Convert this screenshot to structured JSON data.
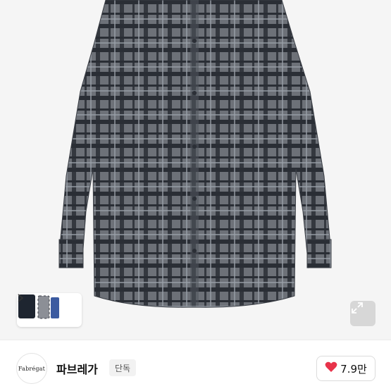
{
  "hero": {
    "image": "plaid-shirt-product-photo",
    "expand_icon": "expand-icon",
    "thumbnails_icon": "chevron-right-icon"
  },
  "brand": {
    "logo_text": "Fabrégat",
    "name": "파브레가",
    "badge": "단독"
  },
  "like": {
    "icon": "heart-icon",
    "count": "7.9만",
    "heart_color": "#e8334a"
  }
}
